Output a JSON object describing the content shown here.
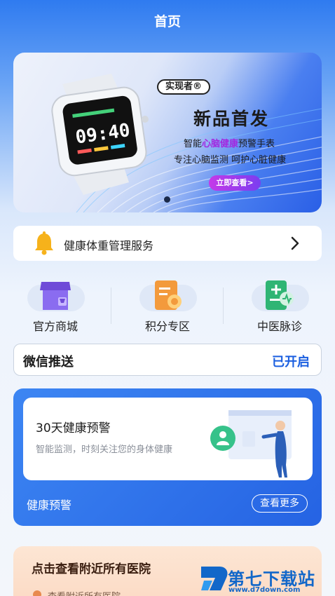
{
  "header": {
    "title": "首页"
  },
  "banner": {
    "brand": "实现者®",
    "headline": "新品首发",
    "line1_pre": "智能",
    "line1_highlight": "心脑健康",
    "line1_post": "预警手表",
    "line2": "专注心脑监测  呵护心脏健康",
    "cta": "立即查看>",
    "watch_time": "09:40",
    "highlight_color": "#a229e0"
  },
  "service": {
    "label": "健康体重管理服务",
    "icon": "bell-icon"
  },
  "quick_entries": [
    {
      "label": "官方商城",
      "icon": "store-icon"
    },
    {
      "label": "积分专区",
      "icon": "points-icon"
    },
    {
      "label": "中医脉诊",
      "icon": "tcm-pulse-icon"
    }
  ],
  "wechat": {
    "title": "微信推送",
    "status": "已开启",
    "status_color": "#1b5fe0"
  },
  "alert": {
    "title": "30天健康预警",
    "subtitle": "智能监测，时刻关注您的身体健康",
    "footer_label": "健康预警",
    "more": "查看更多"
  },
  "hospital": {
    "title": "点击查看附近所有医院",
    "subtitle": "查看附近所有医院"
  },
  "watermark": {
    "text": "第七下载站",
    "url": "www.d7down.com"
  }
}
